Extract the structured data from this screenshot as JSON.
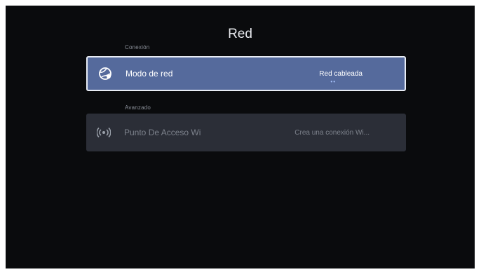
{
  "title": "Red",
  "sections": [
    {
      "header": "Conexión",
      "item": {
        "label": "Modo de red",
        "value": "Red cableada",
        "icon": "globe-network-icon"
      }
    },
    {
      "header": "Avanzado",
      "item": {
        "label": "Punto De Acceso Wi",
        "value": "Crea una conexión Wi...",
        "icon": "wifi-hotspot-icon"
      }
    }
  ],
  "colors": {
    "background": "#0a0b0d",
    "focused_row": "#556a9c",
    "row": "#2b2e37"
  }
}
